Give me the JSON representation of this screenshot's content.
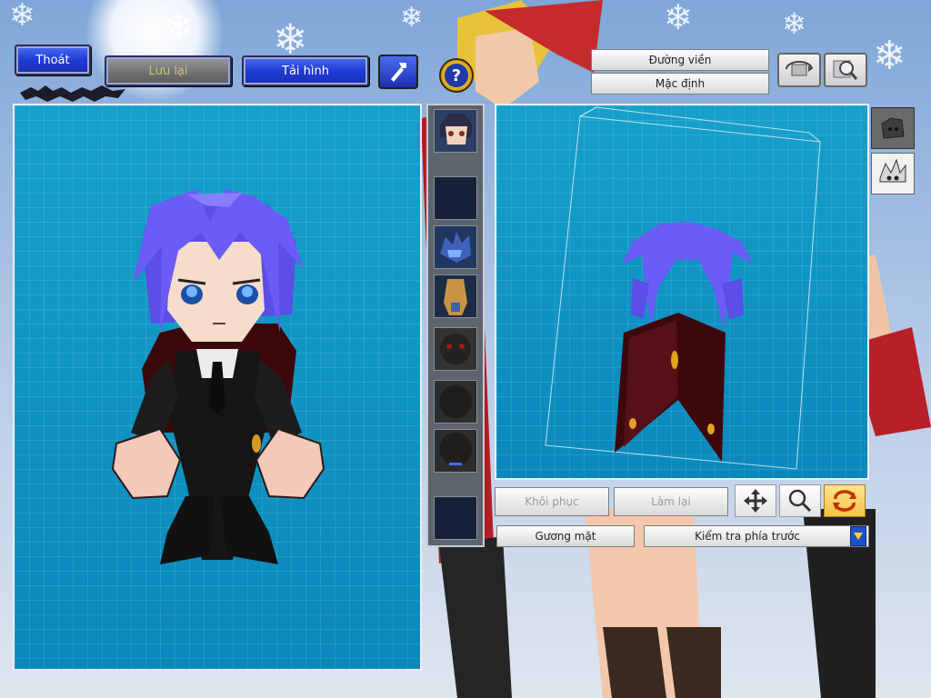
{
  "toolbar": {
    "exit_label": "Thoát",
    "save_label": "Lưu lại",
    "reload_label": "Tải hình",
    "hammer_icon": "hammer-icon",
    "help_icon": "question-icon"
  },
  "view_options": {
    "outline_label": "Đường viền",
    "default_label": "Mặc định"
  },
  "part_slots": [
    {
      "name": "face-slot",
      "content": "face"
    },
    {
      "name": "empty-slot-1",
      "content": "empty"
    },
    {
      "name": "hair-slot",
      "content": "hair"
    },
    {
      "name": "body-slot",
      "content": "body"
    },
    {
      "name": "mask-slot",
      "content": "mask"
    },
    {
      "name": "shape-slot-1",
      "content": "shape"
    },
    {
      "name": "shape-slot-2",
      "content": "shape"
    },
    {
      "name": "empty-slot-2",
      "content": "empty"
    }
  ],
  "editor_actions": {
    "restore_label": "Khôi phục",
    "redo_label": "Làm lại",
    "mirror_label": "Gương mặt"
  },
  "view_select": {
    "selected": "Kiểm tra phía trước"
  },
  "colors": {
    "grid_panel": "#0e97c4",
    "hair": "#6b5cf5",
    "suit": "#151515",
    "cape": "#5a0b10",
    "accent_button": "#1f3bd6"
  }
}
